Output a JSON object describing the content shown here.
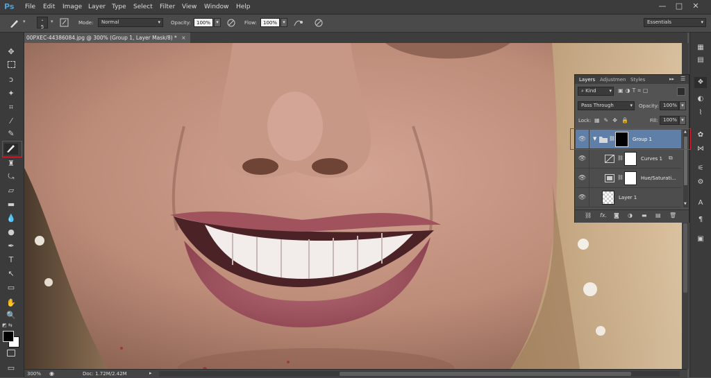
{
  "app": {
    "logo": "Ps"
  },
  "menu": [
    "File",
    "Edit",
    "Image",
    "Layer",
    "Type",
    "Select",
    "Filter",
    "View",
    "Window",
    "Help"
  ],
  "window_controls": {
    "minimize": "—",
    "maximize": "□",
    "close": "✕"
  },
  "options_bar": {
    "brush_size": "5",
    "mode_label": "Mode:",
    "mode_value": "Normal",
    "opacity_label": "Opacity:",
    "opacity_value": "100%",
    "flow_label": "Flow:",
    "flow_value": "100%",
    "workspace": "Essentials"
  },
  "document": {
    "tab_title": "00PXEC-44386084.jpg @ 300% (Group 1, Layer Mask/8) *",
    "close": "×"
  },
  "status": {
    "zoom": "300%",
    "doc_info": "Doc: 1.72M/2.42M"
  },
  "layers_panel": {
    "tabs": [
      "Layers",
      "Adjustmen",
      "Styles"
    ],
    "filter_kind": "Kind",
    "blend_mode": "Pass Through",
    "opacity_label": "Opacity:",
    "opacity_value": "100%",
    "lock_label": "Lock:",
    "fill_label": "Fill:",
    "fill_value": "100%",
    "layers": [
      {
        "name": "Group 1",
        "type": "group",
        "selected": true
      },
      {
        "name": "Curves 1",
        "type": "curves-adjustment"
      },
      {
        "name": "Hue/Saturati...",
        "type": "hue-saturation-adjustment"
      },
      {
        "name": "Layer 1",
        "type": "pixel-layer"
      }
    ],
    "footer_icons": [
      "link-icon",
      "fx-icon",
      "add-mask-icon",
      "adjustment-icon",
      "folder-icon",
      "new-layer-icon",
      "trash-icon"
    ]
  },
  "colors": {
    "highlight": "#e0202e",
    "selected_layer": "#5f7ea8",
    "foreground": "#000000",
    "background": "#ffffff",
    "accent": "#4aa3df"
  }
}
